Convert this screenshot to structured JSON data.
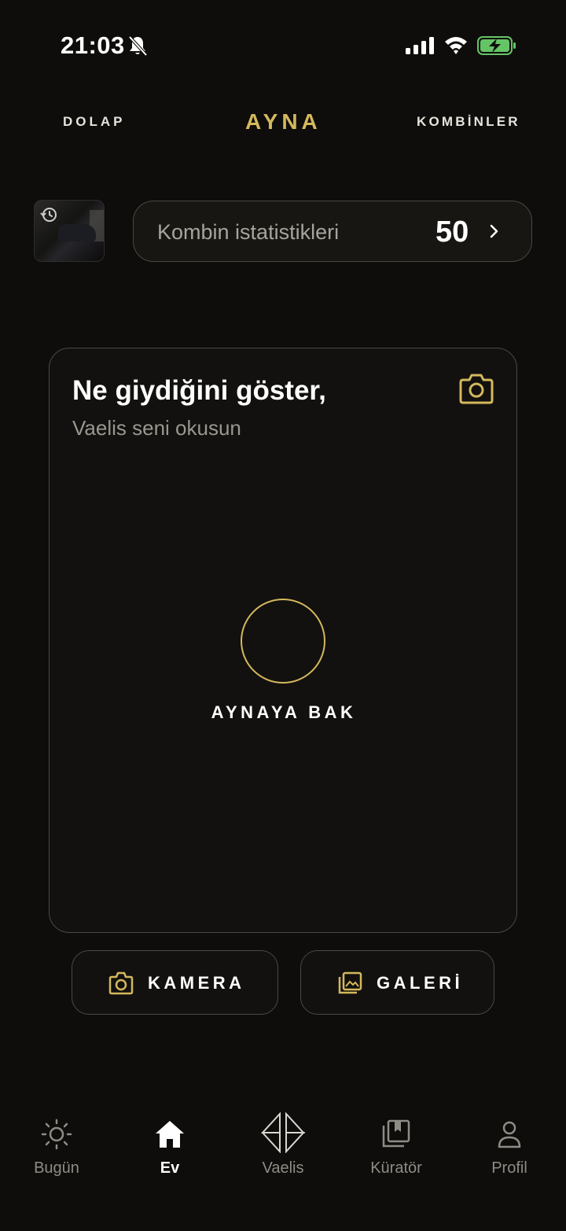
{
  "status_bar": {
    "time": "21:03",
    "icons": [
      "bell-slash-icon",
      "cellular-signal-icon",
      "wifi-icon",
      "battery-charging-icon"
    ]
  },
  "top_tabs": {
    "left": "DOLAP",
    "center": "AYNA",
    "right": "KOMBİNLER",
    "active": "AYNA"
  },
  "stats": {
    "label": "Kombin istatistikleri",
    "count": "50",
    "chevron_icon": "chevron-right-icon",
    "history_icon": "history-icon"
  },
  "mirror_card": {
    "title": "Ne giydiğini göster,",
    "subtitle": "Vaelis seni okusun",
    "camera_icon": "camera-icon",
    "action_label": "AYNAYA BAK"
  },
  "actions": {
    "camera_label": "KAMERA",
    "gallery_label": "GALERİ"
  },
  "bottom_nav": {
    "items": [
      {
        "label": "Bugün",
        "icon": "sun-icon"
      },
      {
        "label": "Ev",
        "icon": "home-icon"
      },
      {
        "label": "Vaelis",
        "icon": "vaelis-logo-icon"
      },
      {
        "label": "Küratör",
        "icon": "bookmark-stack-icon"
      },
      {
        "label": "Profil",
        "icon": "person-icon"
      }
    ],
    "active": "Ev"
  },
  "colors": {
    "background": "#0e0d0b",
    "accent_gold": "#d4b85c",
    "border": "#4b4943",
    "text_primary": "#ffffff",
    "text_muted": "#8f8c85",
    "battery_green": "#65c466"
  }
}
